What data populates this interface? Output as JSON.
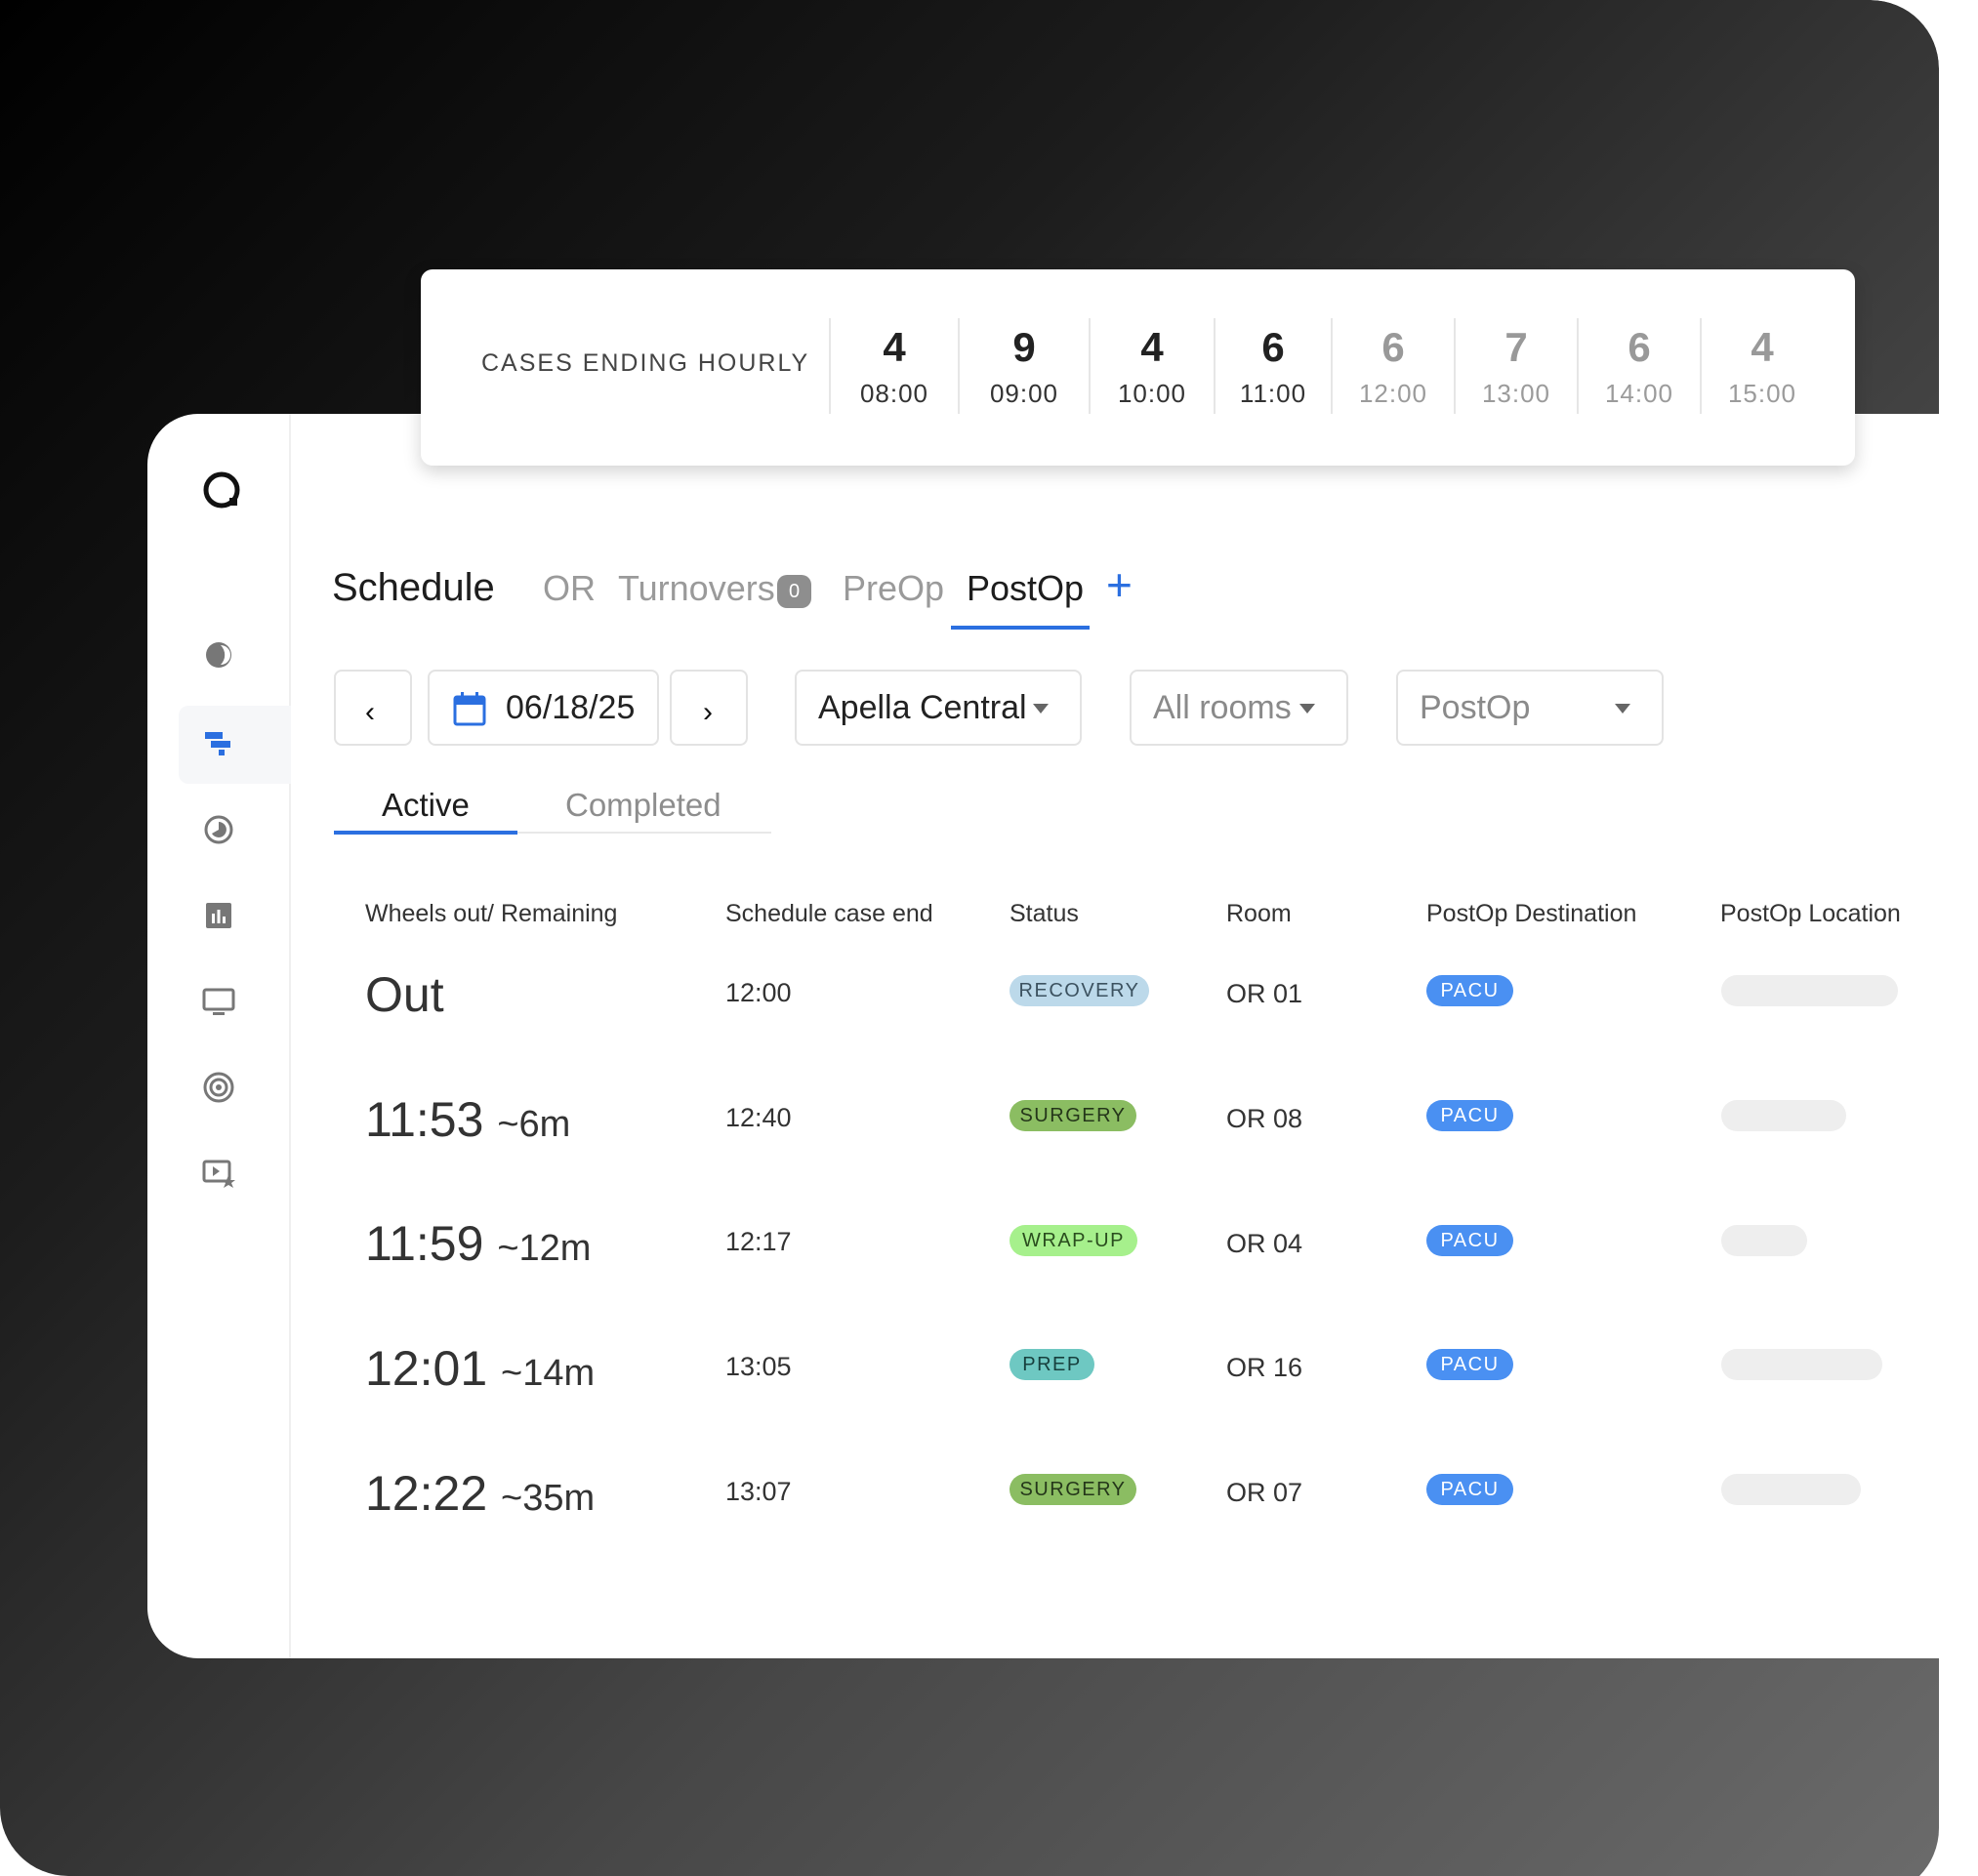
{
  "hourly": {
    "label": "CASES ENDING HOURLY",
    "slots": [
      {
        "count": "4",
        "time": "08:00"
      },
      {
        "count": "9",
        "time": "09:00"
      },
      {
        "count": "4",
        "time": "10:00"
      },
      {
        "count": "6",
        "time": "11:00"
      },
      {
        "count": "6",
        "time": "12:00"
      },
      {
        "count": "7",
        "time": "13:00"
      },
      {
        "count": "6",
        "time": "14:00"
      },
      {
        "count": "4",
        "time": "15:00"
      }
    ]
  },
  "tabs": {
    "schedule": "Schedule",
    "or": "OR",
    "turnovers": "Turnovers",
    "turnovers_badge": "0",
    "preop": "PreOp",
    "postop": "PostOp",
    "add": "+"
  },
  "filters": {
    "prev": "‹",
    "date": "06/18/25",
    "next": "›",
    "site": "Apella Central",
    "rooms": "All rooms",
    "phase": "PostOp"
  },
  "subtabs": {
    "active": "Active",
    "completed": "Completed"
  },
  "table": {
    "headers": [
      "Wheels out/ Remaining",
      "Schedule case end",
      "Status",
      "Room",
      "PostOp Destination",
      "PostOp Location"
    ],
    "rows": [
      {
        "wheels": "Out",
        "remaining": "",
        "end": "12:00",
        "status": "RECOVERY",
        "room": "OR 01",
        "dest": "PACU"
      },
      {
        "wheels": "11:53",
        "remaining": "~6m",
        "end": "12:40",
        "status": "SURGERY",
        "room": "OR 08",
        "dest": "PACU"
      },
      {
        "wheels": "11:59",
        "remaining": "~12m",
        "end": "12:17",
        "status": "WRAP-UP",
        "room": "OR 04",
        "dest": "PACU"
      },
      {
        "wheels": "12:01",
        "remaining": "~14m",
        "end": "13:05",
        "status": "PREP",
        "room": "OR 16",
        "dest": "PACU"
      },
      {
        "wheels": "12:22",
        "remaining": "~35m",
        "end": "13:07",
        "status": "SURGERY",
        "room": "OR 07",
        "dest": "PACU"
      }
    ]
  },
  "colors": {
    "accent": "#2b6fe0",
    "recovery_bg": "#bcd9ea",
    "surgery_bg": "#8bbd62",
    "wrapup_bg": "#a6f08c",
    "prep_bg": "#6ec8c2",
    "pacu_bg": "#4a90f2"
  }
}
